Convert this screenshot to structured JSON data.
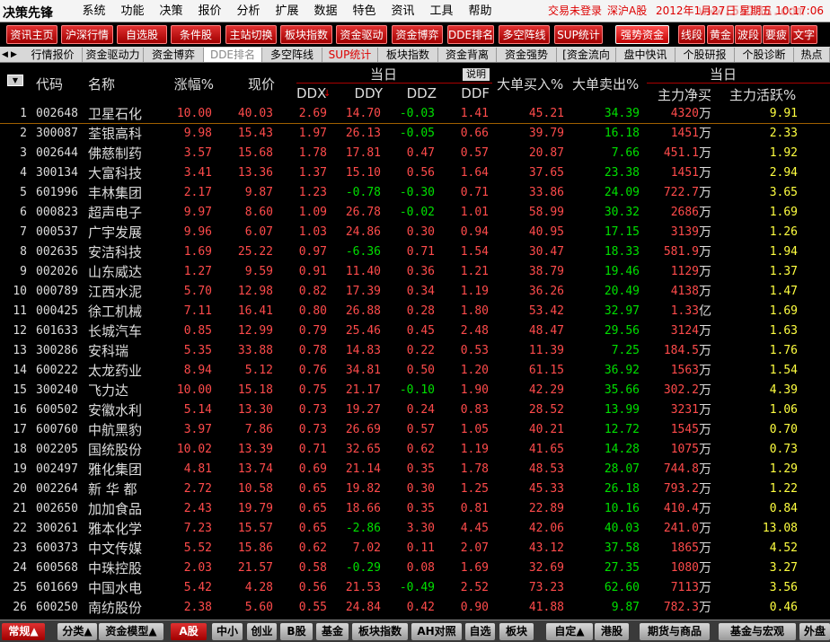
{
  "titlebar": {
    "logo": "决策先锋",
    "menu": [
      "系统",
      "功能",
      "决策",
      "报价",
      "分析",
      "扩展",
      "数据",
      "特色",
      "资讯",
      "工具",
      "帮助"
    ],
    "login_status": "交易未登录",
    "market": "深沪A股",
    "datetime": "2012年1月27日 星期五 10:17:06",
    "watermark": "www.55188.com"
  },
  "toolbar": {
    "buttons": [
      "资讯主页",
      "沪深行情",
      "自选股",
      "条件股",
      "主站切换",
      "板块指数",
      "资金驱动",
      "资金博弈",
      "DDE排名",
      "多空阵线",
      "SUP统计",
      "强势资金",
      "线段",
      "黄金",
      "波段",
      "要疲",
      "文字"
    ],
    "active": "强势资金"
  },
  "tabs": {
    "items": [
      "行情报价",
      "资金驱动力",
      "资金博弈",
      "DDE排名",
      "多空阵线",
      "SUP统计",
      "板块指数",
      "资金背离",
      "资金强势",
      "[资金流向",
      "盘中快讯",
      "个股研报",
      "个股诊断",
      "热点"
    ],
    "selected": "DDE排名",
    "red": "SUP统计"
  },
  "header": {
    "code": "代码",
    "name": "名称",
    "change": "涨幅%",
    "price": "现价",
    "group_today_1": "当日",
    "explain": "说明",
    "ddx": "DDX",
    "ddy": "DDY",
    "ddz": "DDZ",
    "ddf": "DDF",
    "big_buy": "大单买入%",
    "big_sell": "大单卖出%",
    "group_today_2": "当日",
    "main_net": "主力净买",
    "main_active": "主力活跃%",
    "sort_arrow": "↓"
  },
  "rows": [
    {
      "idx": "1",
      "code": "002648",
      "name": "卫星石化",
      "chg": "10.00",
      "price": "40.03",
      "ddx": "2.69",
      "ddy": "14.70",
      "ddz": "-0.03",
      "ddf": "1.41",
      "buy": "45.21",
      "sell": "34.39",
      "net": "4320",
      "unit": "万",
      "active": "9.91"
    },
    {
      "idx": "2",
      "code": "300087",
      "name": "荃银高科",
      "chg": "9.98",
      "price": "15.43",
      "ddx": "1.97",
      "ddy": "26.13",
      "ddz": "-0.05",
      "ddf": "0.66",
      "buy": "39.79",
      "sell": "16.18",
      "net": "1451",
      "unit": "万",
      "active": "2.33"
    },
    {
      "idx": "3",
      "code": "002644",
      "name": "佛慈制药",
      "chg": "3.57",
      "price": "15.68",
      "ddx": "1.78",
      "ddy": "17.81",
      "ddz": "0.47",
      "ddf": "0.57",
      "buy": "20.87",
      "sell": "7.66",
      "net": "451.1",
      "unit": "万",
      "active": "1.92"
    },
    {
      "idx": "4",
      "code": "300134",
      "name": "大富科技",
      "chg": "3.41",
      "price": "13.36",
      "ddx": "1.37",
      "ddy": "15.10",
      "ddz": "0.56",
      "ddf": "1.64",
      "buy": "37.65",
      "sell": "23.38",
      "net": "1451",
      "unit": "万",
      "active": "2.94"
    },
    {
      "idx": "5",
      "code": "601996",
      "name": "丰林集团",
      "chg": "2.17",
      "price": "9.87",
      "ddx": "1.23",
      "ddy": "-0.78",
      "ddz": "-0.30",
      "ddf": "0.71",
      "buy": "33.86",
      "sell": "24.09",
      "net": "722.7",
      "unit": "万",
      "active": "3.65"
    },
    {
      "idx": "6",
      "code": "000823",
      "name": "超声电子",
      "chg": "9.97",
      "price": "8.60",
      "ddx": "1.09",
      "ddy": "26.78",
      "ddz": "-0.02",
      "ddf": "1.01",
      "buy": "58.99",
      "sell": "30.32",
      "net": "2686",
      "unit": "万",
      "active": "1.69"
    },
    {
      "idx": "7",
      "code": "000537",
      "name": "广宇发展",
      "chg": "9.96",
      "price": "6.07",
      "ddx": "1.03",
      "ddy": "24.86",
      "ddz": "0.30",
      "ddf": "0.94",
      "buy": "40.95",
      "sell": "17.15",
      "net": "3139",
      "unit": "万",
      "active": "1.26"
    },
    {
      "idx": "8",
      "code": "002635",
      "name": "安洁科技",
      "chg": "1.69",
      "price": "25.22",
      "ddx": "0.97",
      "ddy": "-6.36",
      "ddz": "0.71",
      "ddf": "1.54",
      "buy": "30.47",
      "sell": "18.33",
      "net": "581.9",
      "unit": "万",
      "active": "1.94"
    },
    {
      "idx": "9",
      "code": "002026",
      "name": "山东威达",
      "chg": "1.27",
      "price": "9.59",
      "ddx": "0.91",
      "ddy": "11.40",
      "ddz": "0.36",
      "ddf": "1.21",
      "buy": "38.79",
      "sell": "19.46",
      "net": "1129",
      "unit": "万",
      "active": "1.37"
    },
    {
      "idx": "10",
      "code": "000789",
      "name": "江西水泥",
      "chg": "5.70",
      "price": "12.98",
      "ddx": "0.82",
      "ddy": "17.39",
      "ddz": "0.34",
      "ddf": "1.19",
      "buy": "36.26",
      "sell": "20.49",
      "net": "4138",
      "unit": "万",
      "active": "1.47"
    },
    {
      "idx": "11",
      "code": "000425",
      "name": "徐工机械",
      "chg": "7.11",
      "price": "16.41",
      "ddx": "0.80",
      "ddy": "26.88",
      "ddz": "0.28",
      "ddf": "1.80",
      "buy": "53.42",
      "sell": "32.97",
      "net": "1.33",
      "unit": "亿",
      "active": "1.69"
    },
    {
      "idx": "12",
      "code": "601633",
      "name": "长城汽车",
      "chg": "0.85",
      "price": "12.99",
      "ddx": "0.79",
      "ddy": "25.46",
      "ddz": "0.45",
      "ddf": "2.48",
      "buy": "48.47",
      "sell": "29.56",
      "net": "3124",
      "unit": "万",
      "active": "1.63"
    },
    {
      "idx": "13",
      "code": "300286",
      "name": "安科瑞",
      "chg": "5.35",
      "price": "33.88",
      "ddx": "0.78",
      "ddy": "14.83",
      "ddz": "0.22",
      "ddf": "0.53",
      "buy": "11.39",
      "sell": "7.25",
      "net": "184.5",
      "unit": "万",
      "active": "1.76"
    },
    {
      "idx": "14",
      "code": "600222",
      "name": "太龙药业",
      "chg": "8.94",
      "price": "5.12",
      "ddx": "0.76",
      "ddy": "34.81",
      "ddz": "0.50",
      "ddf": "1.20",
      "buy": "61.15",
      "sell": "36.92",
      "net": "1563",
      "unit": "万",
      "active": "1.54"
    },
    {
      "idx": "15",
      "code": "300240",
      "name": "飞力达",
      "chg": "10.00",
      "price": "15.18",
      "ddx": "0.75",
      "ddy": "21.17",
      "ddz": "-0.10",
      "ddf": "1.90",
      "buy": "42.29",
      "sell": "35.66",
      "net": "302.2",
      "unit": "万",
      "active": "4.39"
    },
    {
      "idx": "16",
      "code": "600502",
      "name": "安徽水利",
      "chg": "5.14",
      "price": "13.30",
      "ddx": "0.73",
      "ddy": "19.27",
      "ddz": "0.24",
      "ddf": "0.83",
      "buy": "28.52",
      "sell": "13.99",
      "net": "3231",
      "unit": "万",
      "active": "1.06"
    },
    {
      "idx": "17",
      "code": "600760",
      "name": "中航黑豹",
      "chg": "3.97",
      "price": "7.86",
      "ddx": "0.73",
      "ddy": "26.69",
      "ddz": "0.57",
      "ddf": "1.05",
      "buy": "40.21",
      "sell": "12.72",
      "net": "1545",
      "unit": "万",
      "active": "0.70"
    },
    {
      "idx": "18",
      "code": "002205",
      "name": "国统股份",
      "chg": "10.02",
      "price": "13.39",
      "ddx": "0.71",
      "ddy": "32.65",
      "ddz": "0.62",
      "ddf": "1.19",
      "buy": "41.65",
      "sell": "14.28",
      "net": "1075",
      "unit": "万",
      "active": "0.73"
    },
    {
      "idx": "19",
      "code": "002497",
      "name": "雅化集团",
      "chg": "4.81",
      "price": "13.74",
      "ddx": "0.69",
      "ddy": "21.14",
      "ddz": "0.35",
      "ddf": "1.78",
      "buy": "48.53",
      "sell": "28.07",
      "net": "744.8",
      "unit": "万",
      "active": "1.29"
    },
    {
      "idx": "20",
      "code": "002264",
      "name": "新 华 都",
      "chg": "2.72",
      "price": "10.58",
      "ddx": "0.65",
      "ddy": "19.82",
      "ddz": "0.30",
      "ddf": "1.25",
      "buy": "45.33",
      "sell": "26.18",
      "net": "793.2",
      "unit": "万",
      "active": "1.22"
    },
    {
      "idx": "21",
      "code": "002650",
      "name": "加加食品",
      "chg": "2.43",
      "price": "19.79",
      "ddx": "0.65",
      "ddy": "18.66",
      "ddz": "0.35",
      "ddf": "0.81",
      "buy": "22.89",
      "sell": "10.16",
      "net": "410.4",
      "unit": "万",
      "active": "0.84"
    },
    {
      "idx": "22",
      "code": "300261",
      "name": "雅本化学",
      "chg": "7.23",
      "price": "15.57",
      "ddx": "0.65",
      "ddy": "-2.86",
      "ddz": "3.30",
      "ddf": "4.45",
      "buy": "42.06",
      "sell": "40.03",
      "net": "241.0",
      "unit": "万",
      "active": "13.08"
    },
    {
      "idx": "23",
      "code": "600373",
      "name": "中文传媒",
      "chg": "5.52",
      "price": "15.86",
      "ddx": "0.62",
      "ddy": "7.02",
      "ddz": "0.11",
      "ddf": "2.07",
      "buy": "43.12",
      "sell": "37.58",
      "net": "1865",
      "unit": "万",
      "active": "4.52"
    },
    {
      "idx": "24",
      "code": "600568",
      "name": "中珠控股",
      "chg": "2.03",
      "price": "21.57",
      "ddx": "0.58",
      "ddy": "-0.29",
      "ddz": "0.08",
      "ddf": "1.69",
      "buy": "32.69",
      "sell": "27.35",
      "net": "1080",
      "unit": "万",
      "active": "3.27"
    },
    {
      "idx": "25",
      "code": "601669",
      "name": "中国水电",
      "chg": "5.42",
      "price": "4.28",
      "ddx": "0.56",
      "ddy": "21.53",
      "ddz": "-0.49",
      "ddf": "2.52",
      "buy": "73.23",
      "sell": "62.60",
      "net": "7113",
      "unit": "万",
      "active": "3.56"
    },
    {
      "idx": "26",
      "code": "600250",
      "name": "南纺股份",
      "chg": "2.38",
      "price": "5.60",
      "ddx": "0.55",
      "ddy": "24.84",
      "ddz": "0.42",
      "ddf": "0.90",
      "buy": "41.88",
      "sell": "9.87",
      "net": "782.3",
      "unit": "万",
      "active": "0.46"
    }
  ],
  "bottombar": {
    "buttons": [
      "常规▲",
      "分类▲",
      "资金模型▲",
      "A股",
      "中小",
      "创业",
      "B股",
      "基金",
      "板块指数",
      "AH对照",
      "自选",
      "板块",
      "自定▲",
      "港股",
      "期货与商品",
      "基金与宏观",
      "外盘"
    ]
  },
  "colors": {
    "up": "#ff4b4b",
    "down": "#00e000",
    "accent": "#ffff40",
    "toolbar": "#c00000"
  }
}
